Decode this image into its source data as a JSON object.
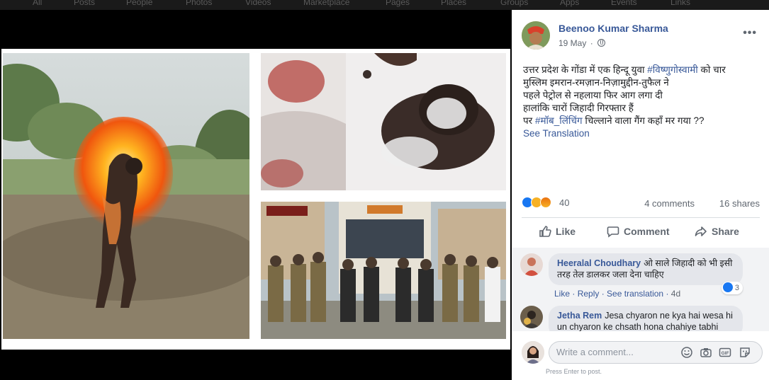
{
  "nav": {
    "items": [
      "All",
      "Posts",
      "People",
      "Photos",
      "Videos",
      "Marketplace",
      "Pages",
      "Places",
      "Groups",
      "Apps",
      "Events",
      "Links"
    ]
  },
  "post": {
    "author": "Beenoo Kumar Sharma",
    "date": "19 May",
    "text_lines": [
      {
        "before": "उत्तर प्रदेश के गोंडा में एक हिन्दू युवा ",
        "tag": "#विष्णुगोस्वामी",
        "after": " को चार"
      },
      {
        "before": "मुस्लिम इमरान-रमज़ान-निज़ामुद्दीन-तुफैल ने",
        "tag": "",
        "after": ""
      },
      {
        "before": "पहले पेट्रोल से नहलाया फिर आग लगा दी",
        "tag": "",
        "after": ""
      },
      {
        "before": "हालांकि चारों जिहादी गिरफ्तार हैं",
        "tag": "",
        "after": ""
      },
      {
        "before": "पर ",
        "tag": "#मॉब_लिंचिंग",
        "after": " चिल्लाने वाला गैंग कहाँ मर गया ??"
      }
    ],
    "see_translation": "See Translation",
    "reaction_count": "40",
    "comments_count": "4 comments",
    "shares_count": "16 shares",
    "actions": {
      "like": "Like",
      "comment": "Comment",
      "share": "Share"
    },
    "more_label": "•••"
  },
  "comments": [
    {
      "name": "Heeralal Choudhary",
      "text": "ओ साले जिहादी को भी इसी तरह तेल डालकर जला देना चाहिए",
      "like": "Like",
      "reply": "Reply",
      "see_translation": "See translation",
      "time": "4d",
      "likes": "3"
    },
    {
      "name": "Jetha Rem",
      "text": "Jesa chyaron ne kya hai wesa hi un chyaron ke chsath hona chahiye tabhi"
    }
  ],
  "composer": {
    "placeholder": "Write a comment...",
    "hint": "Press Enter to post."
  },
  "colors": {
    "link": "#385898",
    "like_blue": "#1877f2",
    "text": "#1c1e21",
    "muted": "#606770"
  },
  "icons": [
    "globe-icon",
    "more-icon",
    "like-icon",
    "comment-icon",
    "share-icon",
    "emoji-icon",
    "camera-icon",
    "gif-icon",
    "sticker-icon"
  ]
}
